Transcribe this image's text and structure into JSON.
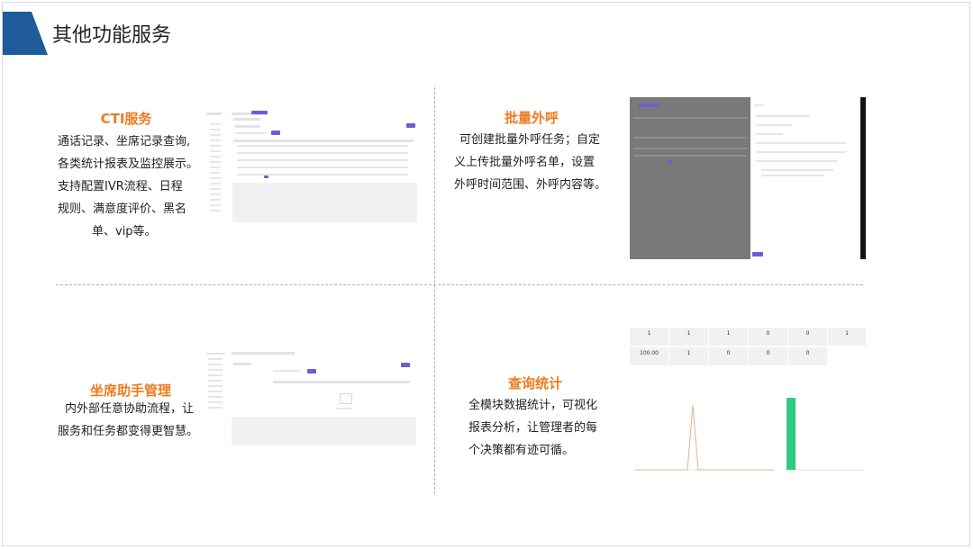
{
  "page": {
    "title": "其他功能服务"
  },
  "sections": [
    {
      "id": "cti",
      "title": "CTI服务",
      "lines": [
        "通话记录、坐席记录查询,",
        "各类统计报表及监控展示。",
        "支持配置IVR流程、日程",
        "规则、满意度评价、黑名",
        "单、vip等。"
      ]
    },
    {
      "id": "batch",
      "title": "批量外呼",
      "lines": [
        "可创建批量外呼任务；自定",
        "义上传批量外呼名单，设置",
        "外呼时间范围、外呼内容等。"
      ]
    },
    {
      "id": "agent",
      "title": "坐席助手管理",
      "lines": [
        "内外部任意协助流程，让",
        "服务和任务都变得更智慧。"
      ]
    },
    {
      "id": "stats",
      "title": "查询统计",
      "lines": [
        "全模块数据统计，可视化",
        "报表分析，让管理者的每",
        "个决策都有迹可循。"
      ]
    }
  ],
  "stats_shot": {
    "cards_row1": [
      "1",
      "1",
      "1",
      "0",
      "0",
      "1"
    ],
    "cards_row2": [
      "100.00",
      "1",
      "0",
      "0",
      "0"
    ]
  },
  "colors": {
    "accent": "#f07a1f",
    "flag": "#1f5a99",
    "line": "#e3b48a",
    "bar": "#2ecc80"
  }
}
